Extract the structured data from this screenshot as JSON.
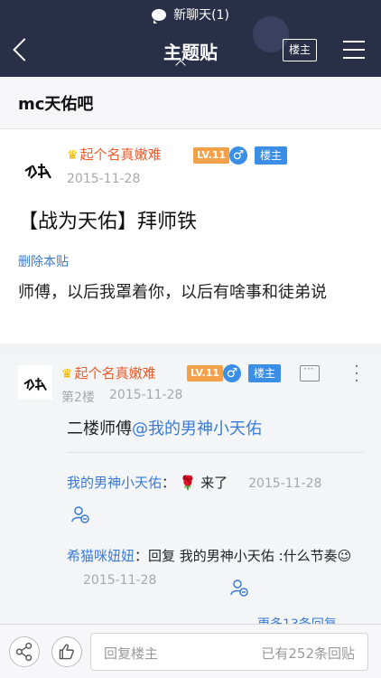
{
  "nav": {
    "notice": "新聊天(1)",
    "title": "主题贴",
    "op_only": "楼主"
  },
  "forum": {
    "name": "mc天佑吧"
  },
  "post": {
    "author": "起个名真嫩难",
    "level": "LV.11",
    "sex_symbol": "♂",
    "role_badge": "楼主",
    "date": "2015-11-28",
    "title": "【战为天佑】拜师铁",
    "delete_link": "删除本贴",
    "body": "师傅，以后我罩着你，以后有啥事和徒弟说"
  },
  "reply": {
    "author": "起个名真嫩难",
    "level": "LV.11",
    "sex_symbol": "♂",
    "role_badge": "楼主",
    "floor": "第2楼",
    "date": "2015-11-28",
    "text_prefix": "二楼师傅",
    "text_mention": "@我的男神小天佑",
    "subreplies": [
      {
        "who": "我的男神小天佑",
        "sep": "：",
        "emoji": "🌹",
        "text": "来了",
        "date": "2015-11-28"
      },
      {
        "who": "希猫咪妞妞",
        "sep": "：",
        "text": "回复 我的男神小天佑 :什么节奏",
        "emoji": "😉",
        "date": "2015-11-28"
      }
    ],
    "more": "更多13条回复"
  },
  "bottom": {
    "placeholder": "回复楼主",
    "count": "已有252条回贴"
  },
  "colors": {
    "nav_bg": "#2a2f48",
    "username": "#e85b2a",
    "level_badge": "#f4a14a",
    "blue_badge": "#3a8ee6",
    "link": "#3a7bd5"
  }
}
